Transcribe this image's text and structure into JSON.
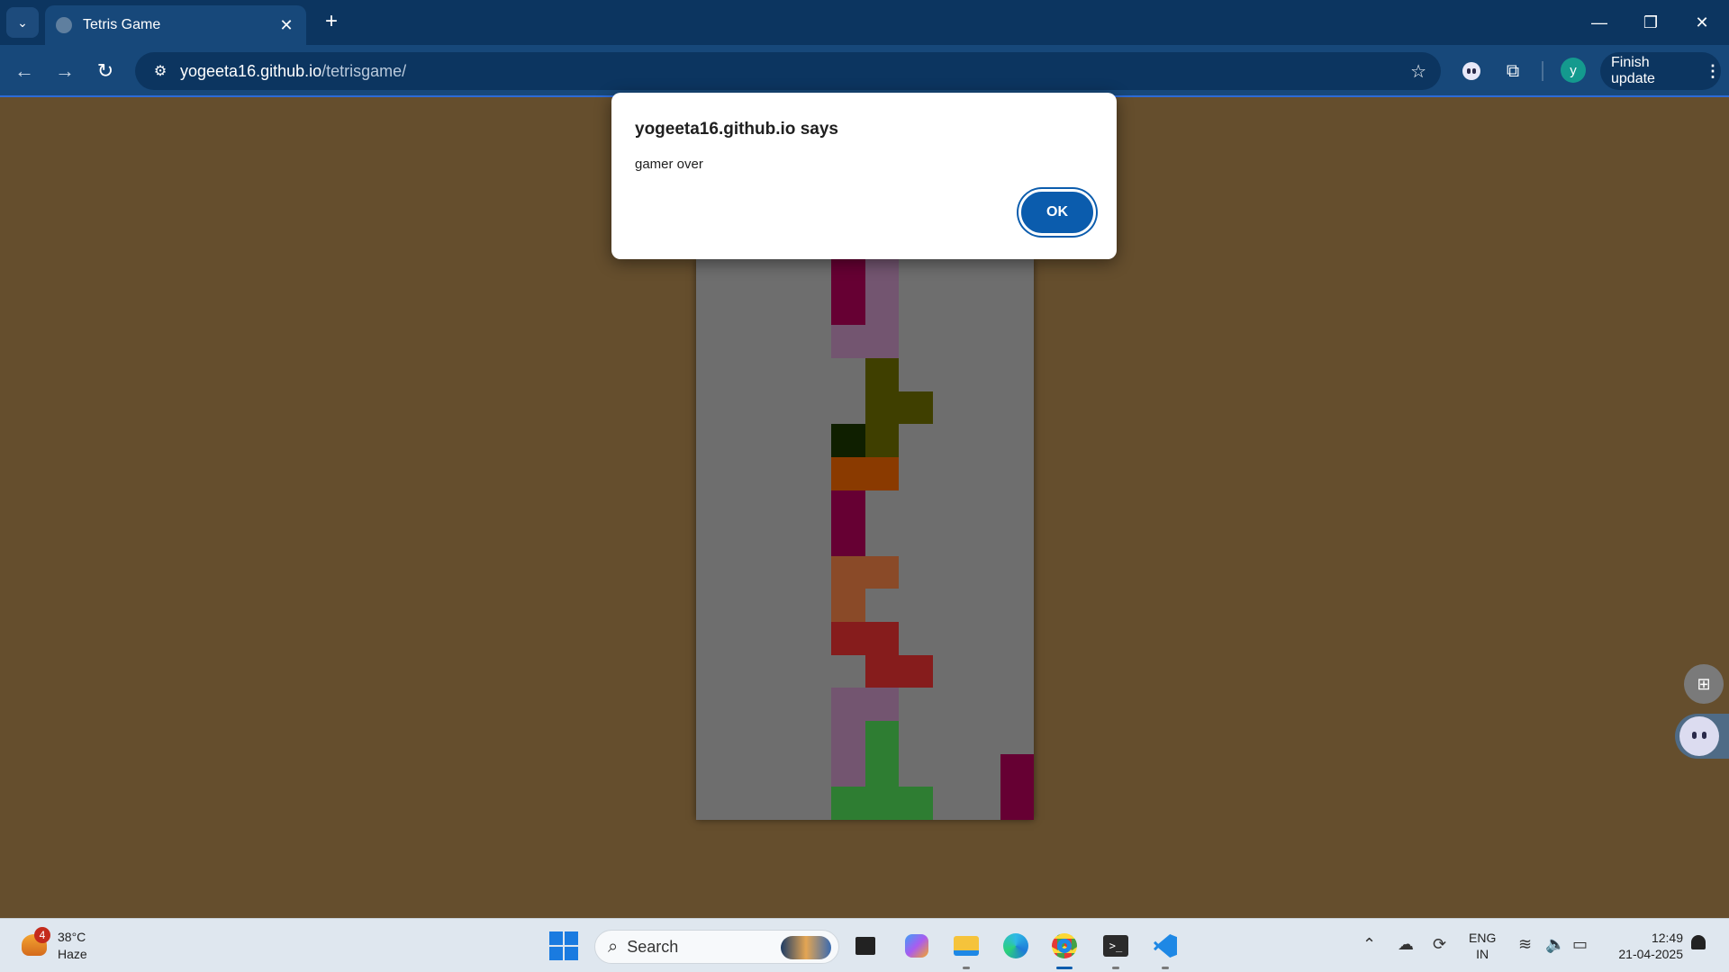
{
  "browser": {
    "tab": {
      "title": "Tetris Game"
    },
    "address": {
      "host": "yogeeta16.github.io",
      "path": "/tetrisgame/"
    },
    "profile_initial": "y",
    "finish_update_label": "Finish update"
  },
  "dialog": {
    "title": "yogeeta16.github.io says",
    "message": "gamer over",
    "ok_label": "OK"
  },
  "game": {
    "columns": 10,
    "rows": 17,
    "board_color": "#6e6e6e",
    "cells": [
      {
        "row": 0,
        "col": 4,
        "color": "#660033"
      },
      {
        "row": 0,
        "col": 5,
        "color": "#735570"
      },
      {
        "row": 1,
        "col": 4,
        "color": "#660033"
      },
      {
        "row": 1,
        "col": 5,
        "color": "#735570"
      },
      {
        "row": 2,
        "col": 4,
        "color": "#735570"
      },
      {
        "row": 2,
        "col": 5,
        "color": "#735570"
      },
      {
        "row": 3,
        "col": 5,
        "color": "#3f3f00"
      },
      {
        "row": 4,
        "col": 5,
        "color": "#3f3f00"
      },
      {
        "row": 4,
        "col": 6,
        "color": "#3f3f00"
      },
      {
        "row": 5,
        "col": 4,
        "color": "#0f1f00"
      },
      {
        "row": 5,
        "col": 5,
        "color": "#3f3f00"
      },
      {
        "row": 6,
        "col": 4,
        "color": "#8a3a00"
      },
      {
        "row": 6,
        "col": 5,
        "color": "#8a3a00"
      },
      {
        "row": 7,
        "col": 4,
        "color": "#660033"
      },
      {
        "row": 8,
        "col": 4,
        "color": "#660033"
      },
      {
        "row": 9,
        "col": 4,
        "color": "#8a4a28"
      },
      {
        "row": 9,
        "col": 5,
        "color": "#8a4a28"
      },
      {
        "row": 10,
        "col": 4,
        "color": "#8a4a28"
      },
      {
        "row": 11,
        "col": 4,
        "color": "#861c1c"
      },
      {
        "row": 11,
        "col": 5,
        "color": "#861c1c"
      },
      {
        "row": 12,
        "col": 5,
        "color": "#861c1c"
      },
      {
        "row": 12,
        "col": 6,
        "color": "#861c1c"
      },
      {
        "row": 13,
        "col": 4,
        "color": "#735570"
      },
      {
        "row": 13,
        "col": 5,
        "color": "#735570"
      },
      {
        "row": 14,
        "col": 4,
        "color": "#735570"
      },
      {
        "row": 14,
        "col": 5,
        "color": "#2e7d32"
      },
      {
        "row": 15,
        "col": 4,
        "color": "#735570"
      },
      {
        "row": 15,
        "col": 5,
        "color": "#2e7d32"
      },
      {
        "row": 15,
        "col": 9,
        "color": "#660033"
      },
      {
        "row": 16,
        "col": 4,
        "color": "#2e7d32"
      },
      {
        "row": 16,
        "col": 5,
        "color": "#2e7d32"
      },
      {
        "row": 16,
        "col": 6,
        "color": "#2e7d32"
      },
      {
        "row": 16,
        "col": 9,
        "color": "#660033"
      }
    ]
  },
  "taskbar": {
    "weather": {
      "badge": "4",
      "temp": "38°C",
      "condition": "Haze"
    },
    "search_placeholder": "Search",
    "language": {
      "line1": "ENG",
      "line2": "IN"
    },
    "clock": {
      "time": "12:49",
      "date": "21-04-2025"
    }
  },
  "colors": {
    "page_background": "#654e2d",
    "titlebar": "#0c3560",
    "toolbar": "#17487a",
    "accent": "#0b5cad"
  }
}
